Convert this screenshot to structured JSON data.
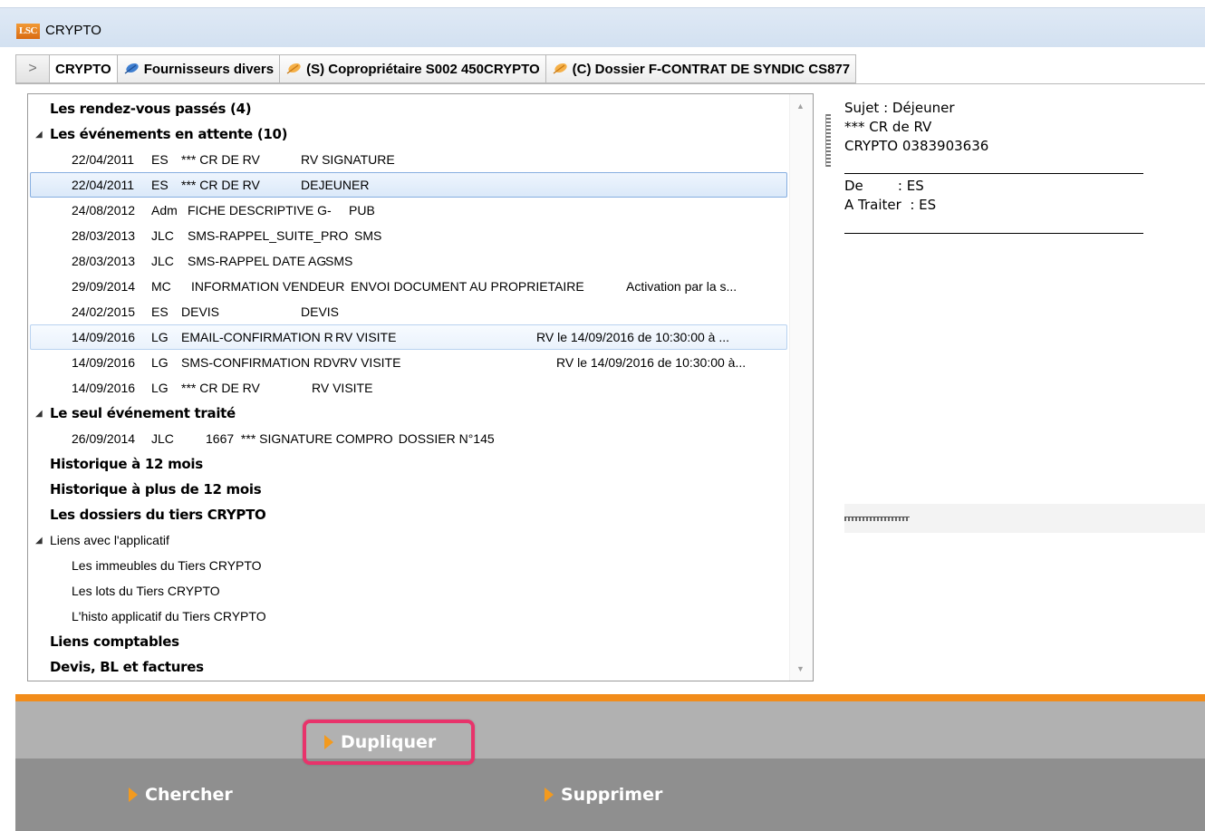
{
  "window": {
    "logo_text": "LSC",
    "title": "CRYPTO"
  },
  "tabs": {
    "toggle": ">",
    "items": [
      {
        "label": "CRYPTO",
        "icon": "none"
      },
      {
        "label": "Fournisseurs divers",
        "icon": "blue-leaf-icon"
      },
      {
        "label": "(S) Copropriétaire S002 450CRYPTO",
        "icon": "orange-leaf-icon"
      },
      {
        "label": "(C) Dossier F-CONTRAT DE SYNDIC CS877",
        "icon": "orange-leaf-icon"
      }
    ]
  },
  "tree": {
    "past_meetings": "Les rendez-vous passés (4)",
    "pending_events": "Les événements en attente (10)",
    "pending_items": [
      {
        "date": "22/04/2011",
        "user": "ES",
        "type": "*** CR DE RV",
        "subject": "RV SIGNATURE",
        "note": ""
      },
      {
        "date": "22/04/2011",
        "user": "ES",
        "type": "*** CR DE RV",
        "subject": "DEJEUNER",
        "note": ""
      },
      {
        "date": "24/08/2012",
        "user": "Adm",
        "type": "FICHE DESCRIPTIVE G-",
        "subject": "PUB",
        "note": ""
      },
      {
        "date": "28/03/2013",
        "user": "JLC",
        "type": "SMS-RAPPEL_SUITE_PRO",
        "subject": "SMS",
        "note": ""
      },
      {
        "date": "28/03/2013",
        "user": "JLC",
        "type": "SMS-RAPPEL DATE AG",
        "subject": "SMS",
        "note": ""
      },
      {
        "date": "29/09/2014",
        "user": "MC",
        "type": "INFORMATION VENDEUR",
        "subject": "ENVOI DOCUMENT AU PROPRIETAIRE",
        "note": "Activation par la s..."
      },
      {
        "date": "24/02/2015",
        "user": "ES",
        "type": "DEVIS",
        "subject": "DEVIS",
        "note": ""
      },
      {
        "date": "14/09/2016",
        "user": "LG",
        "type": "EMAIL-CONFIRMATION R",
        "subject": "RV VISITE",
        "note": "RV le 14/09/2016 de 10:30:00 à ..."
      },
      {
        "date": "14/09/2016",
        "user": "LG",
        "type": "SMS-CONFIRMATION RDV",
        "subject": "RV VISITE",
        "note": "RV le 14/09/2016 de 10:30:00 à..."
      },
      {
        "date": "14/09/2016",
        "user": "LG",
        "type": "*** CR DE RV",
        "subject": "RV VISITE",
        "note": ""
      }
    ],
    "processed_event": "Le seul événement traité",
    "processed_items": [
      {
        "date": "26/09/2014",
        "user": "JLC",
        "type": "1667  *** SIGNATURE COMPRO",
        "subject": "DOSSIER N°145",
        "note": ""
      }
    ],
    "history_12": "Historique à 12 mois",
    "history_more_12": "Historique à plus de 12 mois",
    "third_party_files": "Les dossiers du tiers CRYPTO",
    "app_links": "Liens avec l'applicatif",
    "app_links_items": [
      "Les immeubles du Tiers CRYPTO",
      "Les lots du Tiers CRYPTO",
      "L'histo applicatif du Tiers CRYPTO"
    ],
    "accounting_links": "Liens comptables",
    "quotes_invoices": "Devis, BL et factures"
  },
  "detail": {
    "subject_line": "Sujet : Déjeuner",
    "cr_line": "*** CR de RV",
    "contact_line": "CRYPTO 0383903636",
    "from_line": "De        : ES",
    "to_process_line": "A Traiter  : ES"
  },
  "toolbar": {
    "duplicate": "Dupliquer",
    "search": "Chercher",
    "delete": "Supprimer"
  },
  "colors": {
    "accent_orange": "#f28c1a",
    "highlight": "#e8336b"
  }
}
